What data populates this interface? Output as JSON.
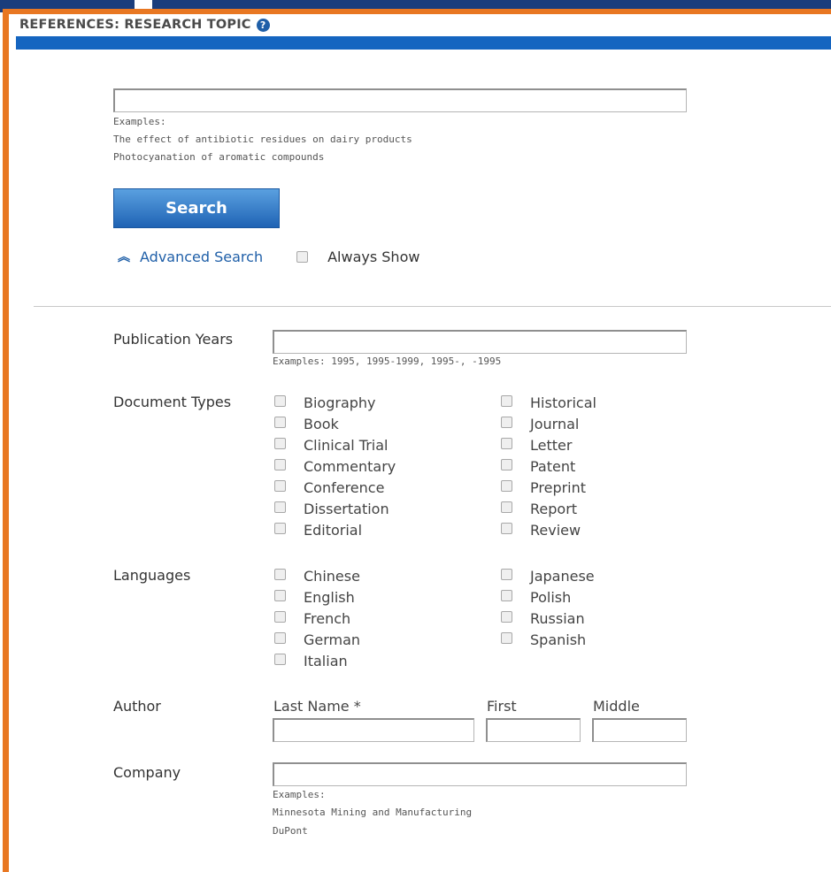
{
  "header": {
    "title": "REFERENCES: RESEARCH TOPIC",
    "help_icon": "?"
  },
  "search": {
    "query_value": "",
    "examples_label": "Examples:",
    "examples": [
      "The effect of antibiotic residues on dairy products",
      "Photocyanation of aromatic compounds"
    ],
    "button_label": "Search"
  },
  "advanced": {
    "toggle_label": "Advanced Search",
    "always_show_label": "Always Show"
  },
  "filters": {
    "publication_years": {
      "label": "Publication Years",
      "value": "",
      "examples": "Examples: 1995, 1995-1999, 1995-, -1995"
    },
    "document_types": {
      "label": "Document Types",
      "col1": [
        "Biography",
        "Book",
        "Clinical Trial",
        "Commentary",
        "Conference",
        "Dissertation",
        "Editorial"
      ],
      "col2": [
        "Historical",
        "Journal",
        "Letter",
        "Patent",
        "Preprint",
        "Report",
        "Review"
      ]
    },
    "languages": {
      "label": "Languages",
      "col1": [
        "Chinese",
        "English",
        "French",
        "German",
        "Italian"
      ],
      "col2": [
        "Japanese",
        "Polish",
        "Russian",
        "Spanish"
      ]
    },
    "author": {
      "label": "Author",
      "last_label": "Last Name *",
      "first_label": "First",
      "middle_label": "Middle"
    },
    "company": {
      "label": "Company",
      "examples_label": "Examples:",
      "examples": [
        "Minnesota Mining and Manufacturing",
        "DuPont"
      ]
    }
  }
}
